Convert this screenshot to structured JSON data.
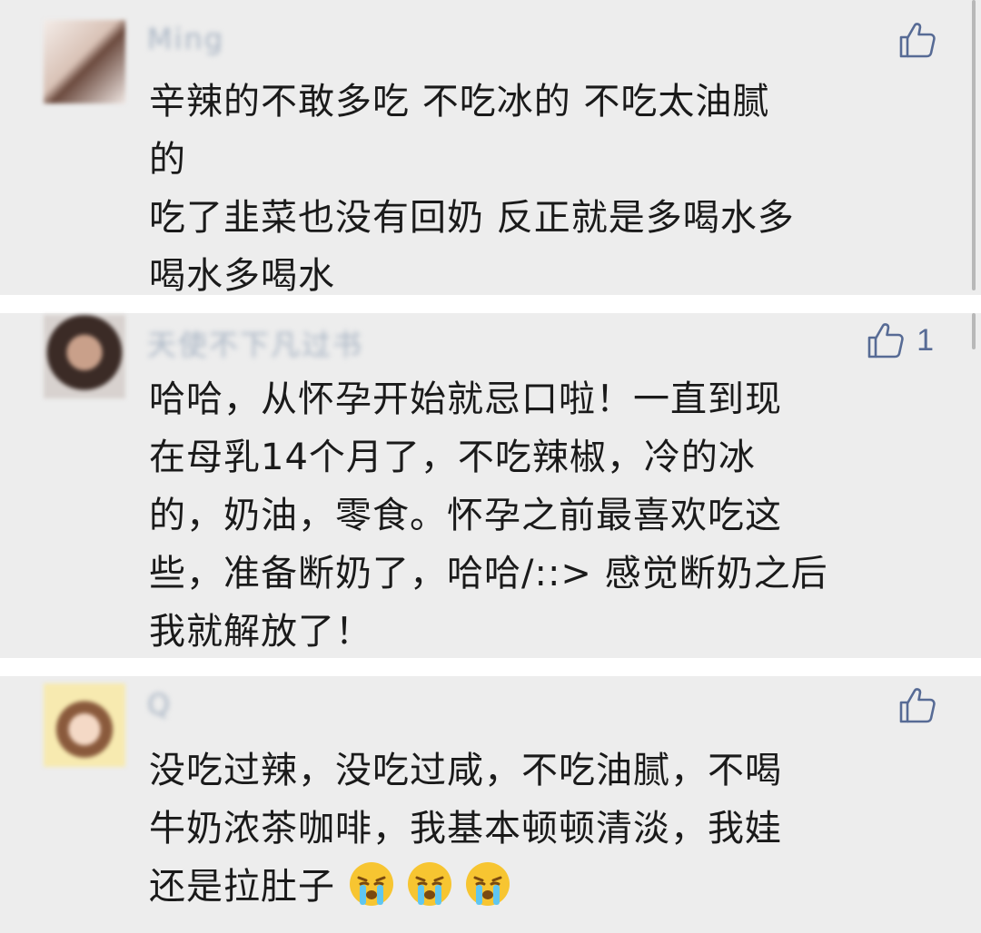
{
  "comments": [
    {
      "nickname": "Ming",
      "likes": "",
      "lines": [
        "辛辣的不敢多吃  不吃冰的    不吃太油腻",
        "的",
        "吃了韭菜也没有回奶  反正就是多喝水多",
        "喝水多喝水"
      ]
    },
    {
      "nickname": "天使不下凡过书",
      "likes": "1",
      "lines": [
        "哈哈，从怀孕开始就忌口啦！一直到现",
        "在母乳14个月了，不吃辣椒，冷的冰",
        "的，奶油，零食。怀孕之前最喜欢吃这",
        "些，准备断奶了，哈哈/::> 感觉断奶之后",
        "我就解放了！"
      ]
    },
    {
      "nickname": "Q",
      "likes": "",
      "lines": [
        "没吃过辣，没吃过咸，不吃油腻，不喝",
        "牛奶浓茶咖啡，我基本顿顿清淡，我娃"
      ],
      "last_line_text": "还是拉肚子",
      "emoji": [
        "crying-face-icon",
        "crying-face-icon",
        "crying-face-icon"
      ]
    }
  ],
  "colors": {
    "background": "#ededed",
    "separator": "#ffffff",
    "link_blue": "#576b95",
    "text": "#1a1a1a"
  }
}
